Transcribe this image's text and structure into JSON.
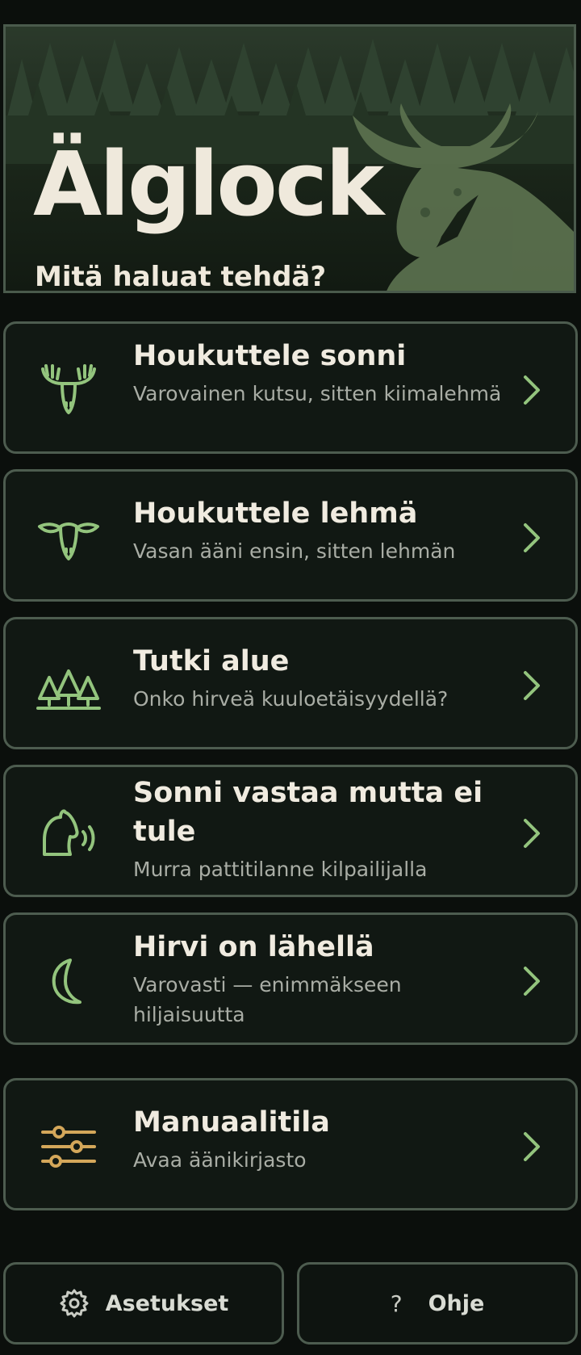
{
  "header": {
    "app_title": "Älglock",
    "subtitle": "Mitä haluat tehdä?"
  },
  "menu": {
    "items": [
      {
        "title": "Houkuttele sonni",
        "subtitle": "Varovainen kutsu, sitten kiimalehmä",
        "icon": "bull-moose-icon"
      },
      {
        "title": "Houkuttele lehmä",
        "subtitle": "Vasan ääni ensin, sitten lehmän",
        "icon": "cow-moose-icon"
      },
      {
        "title": "Tutki alue",
        "subtitle": "Onko hirveä kuuloetäisyydellä?",
        "icon": "forest-trees-icon"
      },
      {
        "title": "Sonni vastaa mutta ei tule",
        "subtitle": "Murra pattitilanne kilpailijalla",
        "icon": "calling-moose-icon"
      },
      {
        "title": "Hirvi on lähellä",
        "subtitle": "Varovasti — enimmäkseen hiljaisuutta",
        "icon": "moon-icon"
      },
      {
        "title": "Manuaalitila",
        "subtitle": "Avaa äänikirjasto",
        "icon": "sliders-icon"
      }
    ]
  },
  "footer": {
    "settings_label": "Asetukset",
    "help_label": "Ohje",
    "help_glyph": "?"
  },
  "colors": {
    "background": "#0b0f0c",
    "card": "#111813",
    "border": "#4d5c4f",
    "accent_green": "#93c47d",
    "accent_gold": "#d4a75a",
    "text": "#f0ebe0",
    "muted": "#a9ada5"
  }
}
